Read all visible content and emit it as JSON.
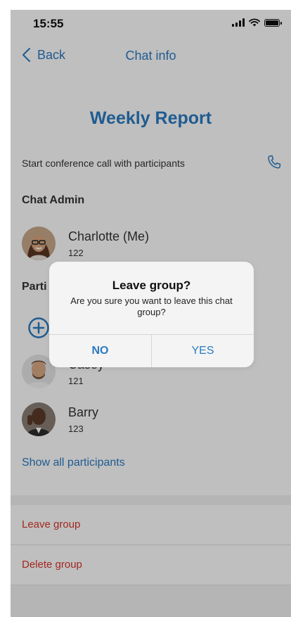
{
  "status_bar": {
    "time": "15:55",
    "icons": [
      "signal-icon",
      "wifi-icon",
      "battery-icon"
    ]
  },
  "nav": {
    "back_label": "Back",
    "title": "Chat info"
  },
  "group": {
    "title": "Weekly Report"
  },
  "conference": {
    "text": "Start conference call with participants",
    "icon": "phone-icon"
  },
  "admin": {
    "heading": "Chat Admin",
    "name": "Charlotte (Me)",
    "number": "122"
  },
  "participants": {
    "heading_visible": "Parti",
    "add_icon": "add-participant-icon",
    "items": [
      {
        "name": "Casey",
        "number": "121"
      },
      {
        "name": "Barry",
        "number": "123"
      }
    ],
    "show_all": "Show all participants"
  },
  "actions": {
    "leave": "Leave group",
    "delete": "Delete group"
  },
  "dialog": {
    "title": "Leave group?",
    "message": "Are you sure you want to leave this chat group?",
    "no_label": "NO",
    "yes_label": "YES"
  },
  "colors": {
    "accent": "#2a7bc1",
    "destructive": "#d9342b",
    "overlay": "rgba(0,0,0,0.25)"
  }
}
